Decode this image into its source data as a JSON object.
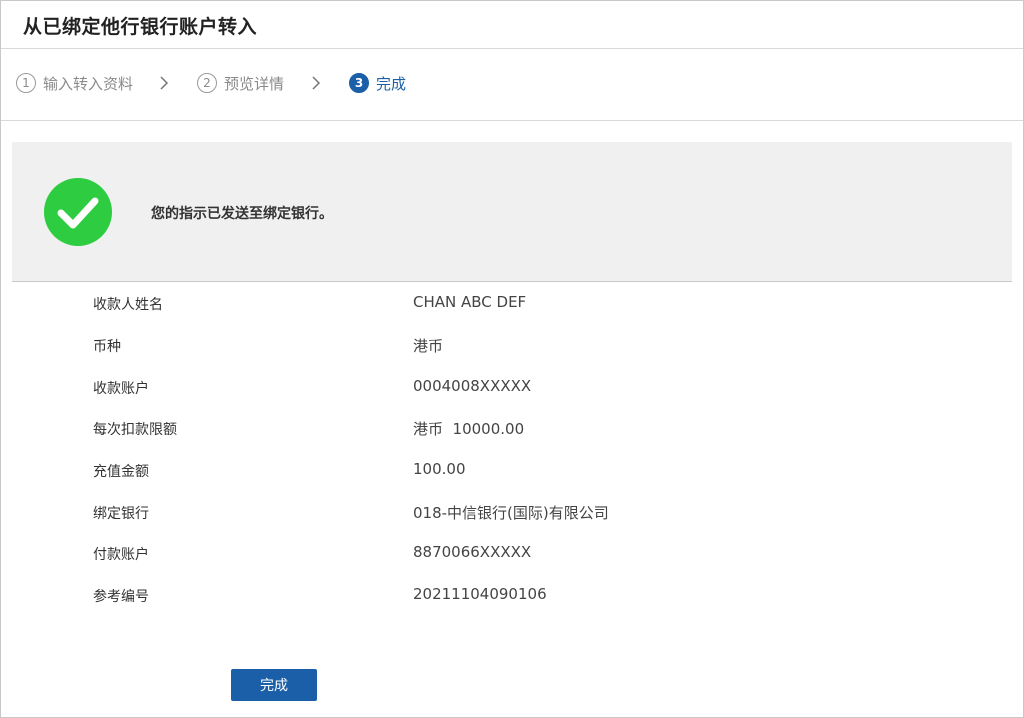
{
  "header": {
    "title": "从已绑定他行银行账户转入"
  },
  "steps": [
    {
      "number": "1",
      "label": "输入转入资料",
      "state": "done"
    },
    {
      "number": "2",
      "label": "预览详情",
      "state": "done"
    },
    {
      "number": "3",
      "label": "完成",
      "state": "active"
    }
  ],
  "banner": {
    "icon": "check-circle-icon",
    "message": "您的指示已发送至绑定银行。",
    "icon_color": "#2ecc40"
  },
  "details": [
    {
      "label": "收款人姓名",
      "value": "CHAN ABC DEF"
    },
    {
      "label": "币种",
      "value": "港币"
    },
    {
      "label": "收款账户",
      "value": "0004008XXXXX"
    },
    {
      "label": "每次扣款限额",
      "value": "港币  10000.00"
    },
    {
      "label": "充值金额",
      "value": "100.00"
    },
    {
      "label": "绑定银行",
      "value": "018-中信银行(国际)有限公司"
    },
    {
      "label": "付款账户",
      "value": "8870066XXXXX"
    },
    {
      "label": "参考编号",
      "value": "20211104090106"
    }
  ],
  "actions": {
    "done_label": "完成"
  },
  "colors": {
    "accent": "#1a5fa8",
    "success": "#2ecc40",
    "banner_bg": "#f0f0f0"
  }
}
